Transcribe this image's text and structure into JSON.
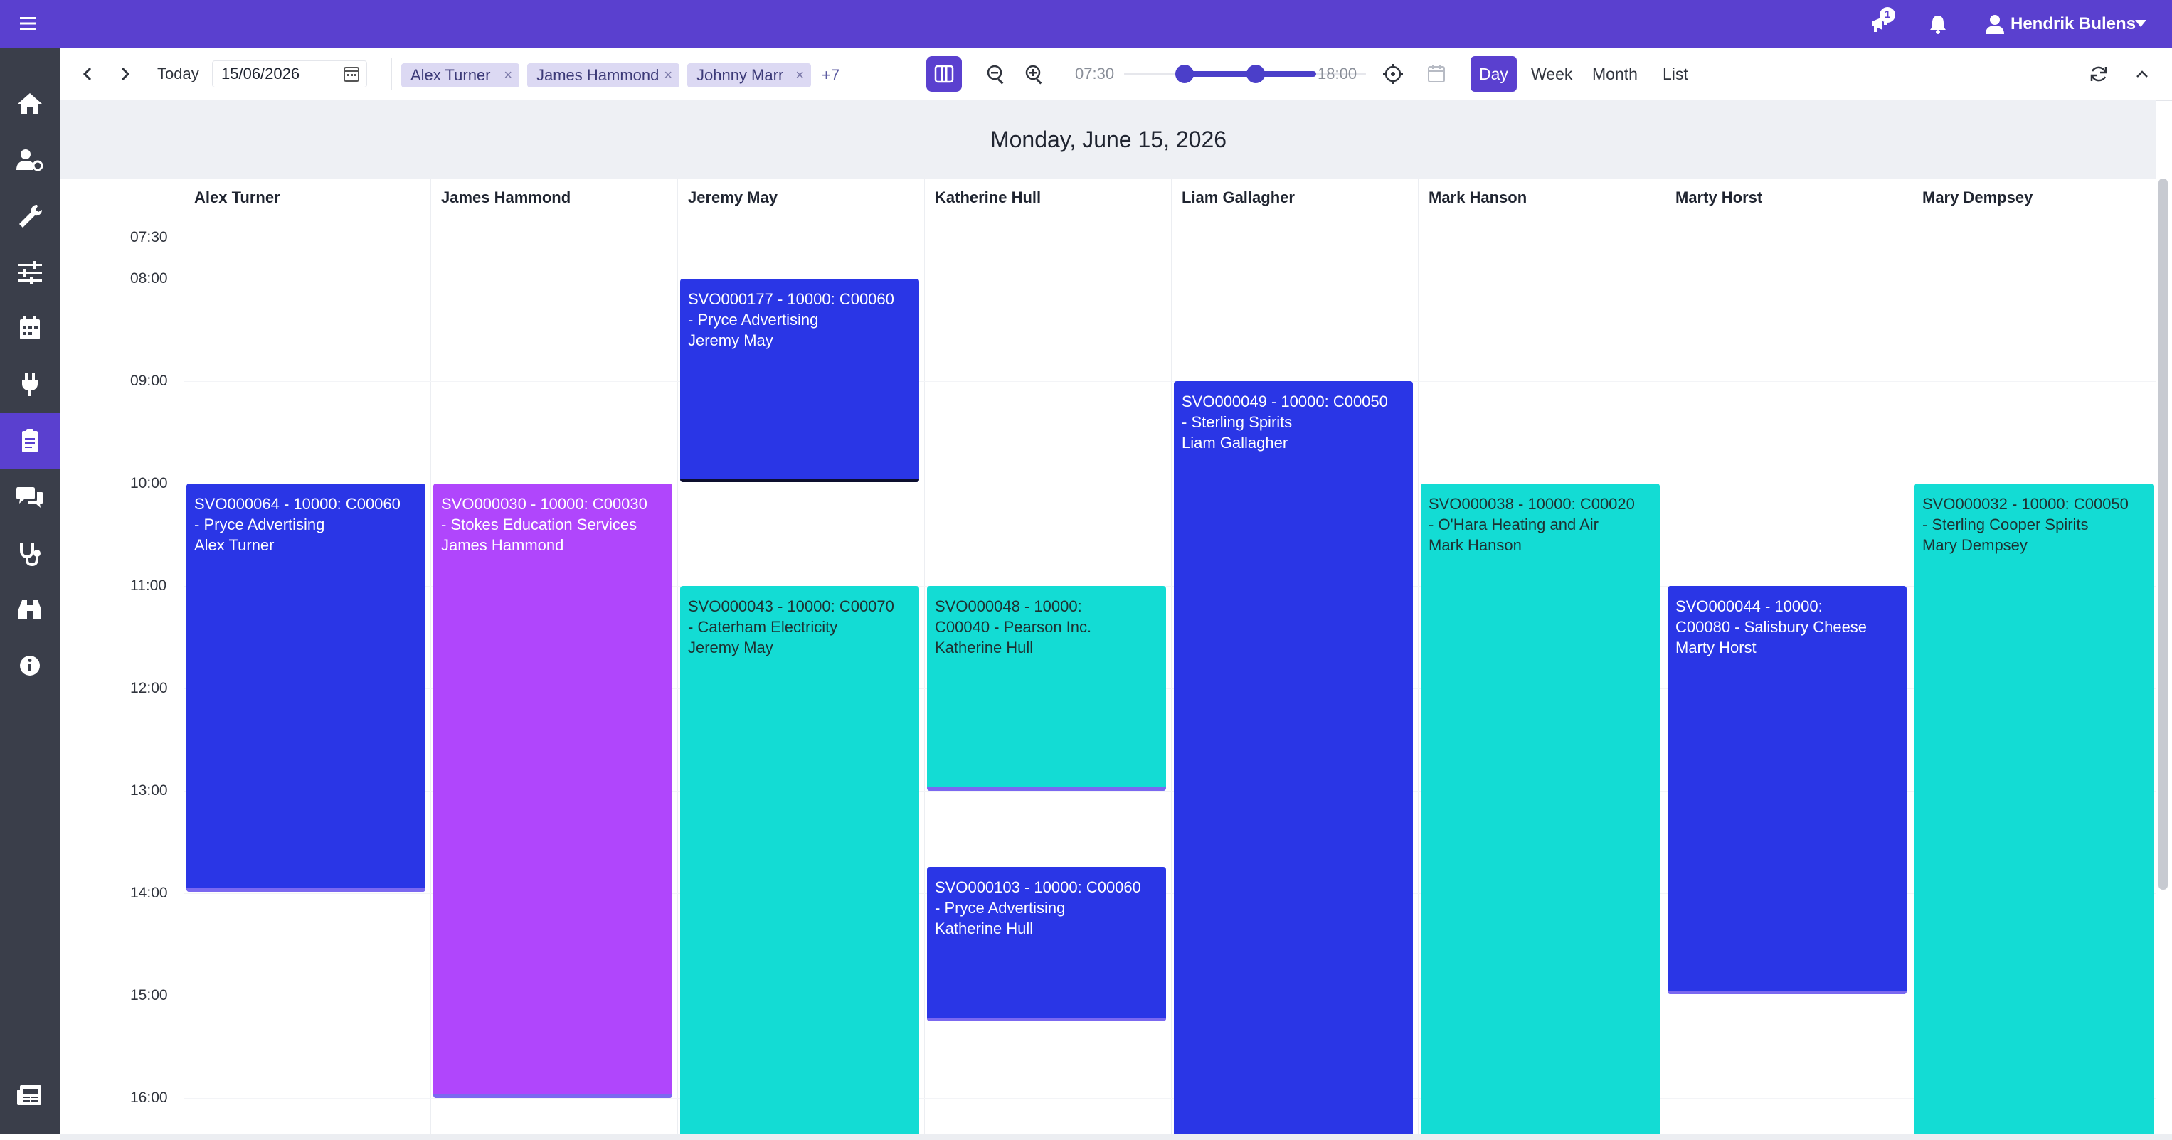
{
  "header": {
    "notification_count": "1",
    "user_name": "Hendrik Bulens"
  },
  "sidebar": {
    "items": [
      {
        "icon": "home-icon",
        "active": false
      },
      {
        "icon": "user-settings-icon",
        "active": false
      },
      {
        "icon": "wrench-icon",
        "active": false
      },
      {
        "icon": "sliders-icon",
        "active": false
      },
      {
        "icon": "calendar-icon",
        "active": false
      },
      {
        "icon": "plug-icon",
        "active": false
      },
      {
        "icon": "clipboard-icon",
        "active": true
      },
      {
        "icon": "chat-icon",
        "active": false
      },
      {
        "icon": "stethoscope-icon",
        "active": false
      },
      {
        "icon": "binoculars-icon",
        "active": false
      },
      {
        "icon": "info-icon",
        "active": false
      },
      {
        "icon": "newspaper-icon",
        "active": false
      }
    ]
  },
  "toolbar": {
    "today_label": "Today",
    "date_value": "15/06/2026",
    "chips": [
      "Alex Turner",
      "James Hammond",
      "Johnny Marr"
    ],
    "chips_more": "+7",
    "time_start": "07:30",
    "time_end": "18:00",
    "views": [
      "Day",
      "Week",
      "Month",
      "List"
    ],
    "active_view": "Day"
  },
  "calendar": {
    "title": "Monday, June 15, 2026",
    "resources": [
      "Alex Turner",
      "James Hammond",
      "Jeremy May",
      "Katherine Hull",
      "Liam Gallagher",
      "Mark Hanson",
      "Marty Horst",
      "Mary Dempsey"
    ],
    "hours": [
      "07:30",
      "08:00",
      "09:00",
      "10:00",
      "11:00",
      "12:00",
      "13:00",
      "14:00",
      "15:00",
      "16:00"
    ],
    "events": [
      {
        "lines": [
          "SVO000064 - 10000: C00060",
          "- Pryce Advertising",
          "Alex Turner"
        ],
        "color": "blue"
      },
      {
        "lines": [
          "SVO000030 - 10000: C00030",
          "- Stokes Education Services",
          "James Hammond"
        ],
        "color": "purple"
      },
      {
        "lines": [
          "SVO000177 - 10000: C00060",
          "- Pryce Advertising",
          "Jeremy May"
        ],
        "color": "blue"
      },
      {
        "lines": [
          "SVO000043 - 10000: C00070",
          "- Caterham Electricity",
          "Jeremy May"
        ],
        "color": "teal"
      },
      {
        "lines": [
          "SVO000048 - 10000:",
          "C00040 - Pearson Inc.",
          "Katherine Hull"
        ],
        "color": "teal"
      },
      {
        "lines": [
          "SVO000103 - 10000: C00060",
          "- Pryce Advertising",
          "Katherine Hull"
        ],
        "color": "blue"
      },
      {
        "lines": [
          "SVO000049 - 10000: C00050",
          "- Sterling Spirits",
          "Liam Gallagher"
        ],
        "color": "blue"
      },
      {
        "lines": [
          "SVO000038 - 10000: C00020",
          "- O'Hara Heating and Air",
          "Mark Hanson"
        ],
        "color": "teal"
      },
      {
        "lines": [
          "SVO000044 - 10000:",
          "C00080 - Salisbury Cheese",
          "Marty Horst"
        ],
        "color": "blue"
      },
      {
        "lines": [
          "SVO000032 - 10000: C00050",
          "- Sterling Cooper Spirits",
          "Mary Dempsey"
        ],
        "color": "teal"
      }
    ]
  },
  "colors": {
    "brand": "#5a40cf",
    "event_blue": "#2a36e6",
    "event_purple": "#b046fc",
    "event_teal": "#13dcd4"
  }
}
